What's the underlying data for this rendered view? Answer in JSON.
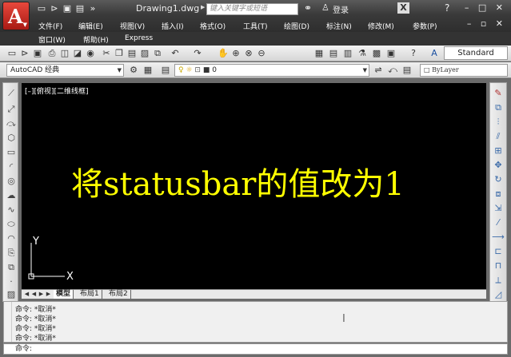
{
  "window": {
    "doc_title": "Drawing1.dwg",
    "search_placeholder": "键入关键字或短语",
    "login_label": "登录",
    "win_controls": "– □ ✕",
    "doc_controls": "– ▫ ✕"
  },
  "menu": {
    "row1": [
      "文件(F)",
      "编辑(E)",
      "视图(V)",
      "插入(I)",
      "格式(O)",
      "工具(T)",
      "绘图(D)",
      "标注(N)",
      "修改(M)",
      "参数(P)"
    ],
    "row2": [
      "窗口(W)",
      "帮助(H)",
      "Express"
    ]
  },
  "toolbar": {
    "text_style": "Standard",
    "workspace": "AutoCAD 经典",
    "layer": "0",
    "linetype": "ByLayer"
  },
  "canvas": {
    "viewport_label": "[–][俯视][二维线框]",
    "text": "将statusbar的值改为1",
    "text_color": "#ffff00",
    "ucs_x": "X",
    "ucs_y": "Y"
  },
  "layout_tabs": [
    "模型",
    "布局1",
    "布局2"
  ],
  "command": {
    "history": [
      "命令: *取消*",
      "命令: *取消*",
      "命令: *取消*",
      "命令: *取消*"
    ],
    "prompt": "命令:"
  }
}
